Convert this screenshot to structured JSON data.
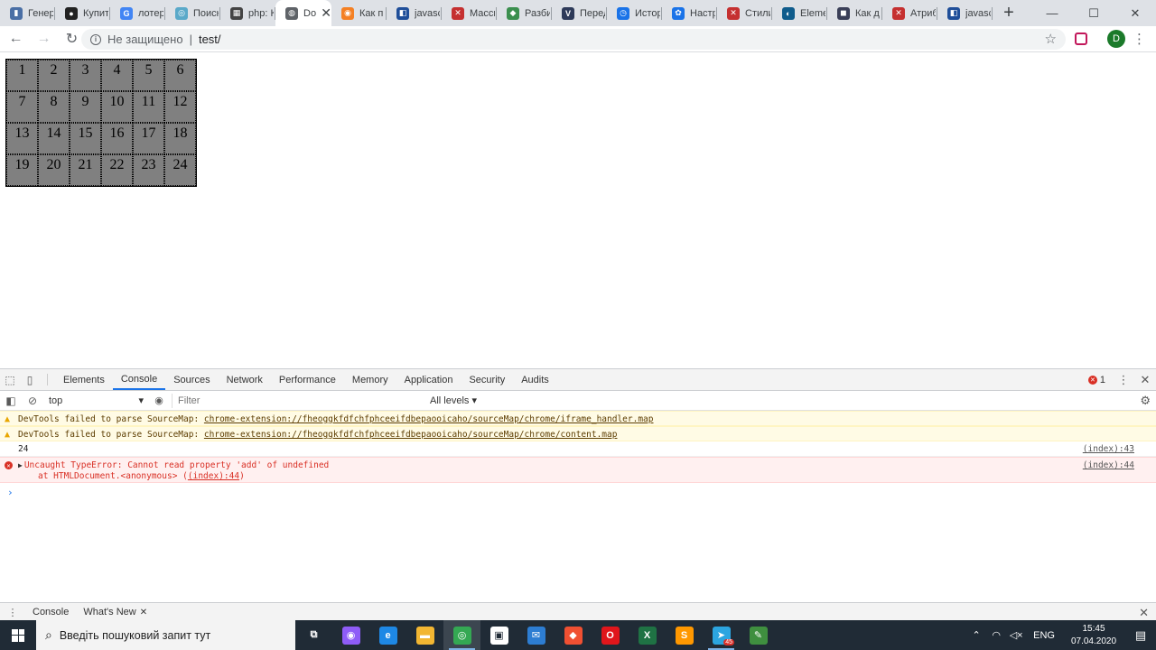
{
  "browser": {
    "tabs": [
      {
        "label": "Генер",
        "fav_color": "#4a6fa5",
        "fav_glyph": "▮"
      },
      {
        "label": "Купит",
        "fav_color": "#222222",
        "fav_glyph": "●"
      },
      {
        "label": "лотер",
        "fav_color": "#4285f4",
        "fav_glyph": "G"
      },
      {
        "label": "Поиск",
        "fav_color": "#5aa9c9",
        "fav_glyph": "◎"
      },
      {
        "label": "php: К",
        "fav_color": "#444444",
        "fav_glyph": "▦"
      },
      {
        "label": "Do",
        "fav_color": "#5f6368",
        "fav_glyph": "◍",
        "active": true
      },
      {
        "label": "Как п",
        "fav_color": "#f48024",
        "fav_glyph": "◉"
      },
      {
        "label": "javasc",
        "fav_color": "#1f4e99",
        "fav_glyph": "◧"
      },
      {
        "label": "Масси",
        "fav_color": "#c53030",
        "fav_glyph": "✕"
      },
      {
        "label": "Разби",
        "fav_color": "#3b8f4e",
        "fav_glyph": "◆"
      },
      {
        "label": "Перед",
        "fav_color": "#2e3a59",
        "fav_glyph": "V"
      },
      {
        "label": "Истор",
        "fav_color": "#1a73e8",
        "fav_glyph": "◷"
      },
      {
        "label": "Настр",
        "fav_color": "#1a73e8",
        "fav_glyph": "✿"
      },
      {
        "label": "Стили",
        "fav_color": "#c53030",
        "fav_glyph": "✕"
      },
      {
        "label": "Eleme",
        "fav_color": "#0f5c8c",
        "fav_glyph": "◐"
      },
      {
        "label": "Как д",
        "fav_color": "#3a3f58",
        "fav_glyph": "◼"
      },
      {
        "label": "Атриб",
        "fav_color": "#c53030",
        "fav_glyph": "✕"
      },
      {
        "label": "javasc",
        "fav_color": "#1f4e99",
        "fav_glyph": "◧"
      }
    ],
    "new_tab_label": "+",
    "window_controls": {
      "minimize": "—",
      "maximize": "☐",
      "close": "✕"
    },
    "address": {
      "security_text": "Не защищено",
      "separator": "|",
      "url": "test/"
    },
    "profile_initial": "D"
  },
  "page": {
    "grid": [
      [
        "1",
        "2",
        "3",
        "4",
        "5",
        "6"
      ],
      [
        "7",
        "8",
        "9",
        "10",
        "11",
        "12"
      ],
      [
        "13",
        "14",
        "15",
        "16",
        "17",
        "18"
      ],
      [
        "19",
        "20",
        "21",
        "22",
        "23",
        "24"
      ]
    ],
    "grid_cell_color": "#808080"
  },
  "devtools": {
    "tabs": [
      "Elements",
      "Console",
      "Sources",
      "Network",
      "Performance",
      "Memory",
      "Application",
      "Security",
      "Audits"
    ],
    "active_tab": "Console",
    "error_count": "1",
    "console_toolbar": {
      "context": "top",
      "filter_placeholder": "Filter",
      "levels": "All levels ▾"
    },
    "messages": [
      {
        "type": "warn",
        "prefix": "DevTools failed to parse SourceMap: ",
        "link": "chrome-extension://fheoggkfdfchfphceeifdbepaooicaho/sourceMap/chrome/iframe_handler.map"
      },
      {
        "type": "warn",
        "prefix": "DevTools failed to parse SourceMap: ",
        "link": "chrome-extension://fheoggkfdfchfphceeifdbepaooicaho/sourceMap/chrome/content.map"
      },
      {
        "type": "log",
        "text": "24",
        "source": "(index):43"
      },
      {
        "type": "error",
        "line1": "Uncaught TypeError: Cannot read property 'add' of undefined",
        "line2_prefix": "at HTMLDocument.<anonymous> (",
        "line2_link": "(index):44",
        "line2_suffix": ")",
        "source": "(index):44"
      }
    ],
    "prompt": "›",
    "drawer": {
      "tabs": [
        "Console",
        "What's New"
      ],
      "close_glyph": "✕"
    }
  },
  "taskbar": {
    "search_placeholder": "Введіть пошуковий запит тут",
    "apps": [
      {
        "name": "task-view",
        "glyph": "⧉",
        "color": "transparent"
      },
      {
        "name": "assistant",
        "glyph": "◉",
        "color": "#8e5cf7"
      },
      {
        "name": "edge",
        "glyph": "e",
        "color": "#1e88e5"
      },
      {
        "name": "explorer",
        "glyph": "▬",
        "color": "#f2b632"
      },
      {
        "name": "chrome",
        "glyph": "◎",
        "color": "#34a853",
        "active": true
      },
      {
        "name": "store",
        "glyph": "▣",
        "color": "#ffffff"
      },
      {
        "name": "mail",
        "glyph": "✉",
        "color": "#2d7dd2"
      },
      {
        "name": "git",
        "glyph": "◆",
        "color": "#f05032"
      },
      {
        "name": "opera",
        "glyph": "O",
        "color": "#e0161b"
      },
      {
        "name": "excel",
        "glyph": "X",
        "color": "#1f7244"
      },
      {
        "name": "sublime",
        "glyph": "S",
        "color": "#ff9800"
      },
      {
        "name": "telegram",
        "glyph": "➤",
        "color": "#2ca5e0",
        "badge": "45",
        "running": true
      },
      {
        "name": "notepad",
        "glyph": "✎",
        "color": "#3f8f3f"
      }
    ],
    "tray": {
      "lang": "ENG",
      "time": "15:45",
      "date": "07.04.2020"
    }
  }
}
